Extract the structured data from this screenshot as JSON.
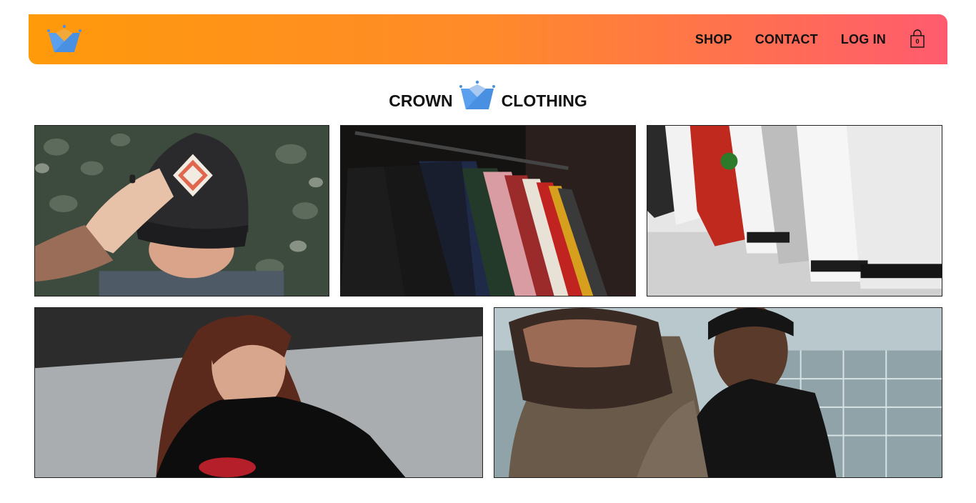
{
  "header": {
    "logo_icon": "crown-icon",
    "gradient_start": "#ff9a0a",
    "gradient_end": "#ff5b6e",
    "nav": [
      {
        "label": "SHOP"
      },
      {
        "label": "CONTACT"
      },
      {
        "label": "LOG IN"
      }
    ],
    "cart": {
      "icon": "shopping-bag-icon",
      "count": "0"
    }
  },
  "brand": {
    "left_word": "CROWN",
    "right_word": "CLOTHING",
    "icon": "crown-icon",
    "crown_color": "#4a90e2"
  },
  "categories": [
    {
      "image": "man-in-cap-photo"
    },
    {
      "image": "jackets-on-rack-photo"
    },
    {
      "image": "sneakers-row-photo"
    },
    {
      "image": "woman-portrait-photo"
    },
    {
      "image": "man-reaching-photo"
    }
  ]
}
